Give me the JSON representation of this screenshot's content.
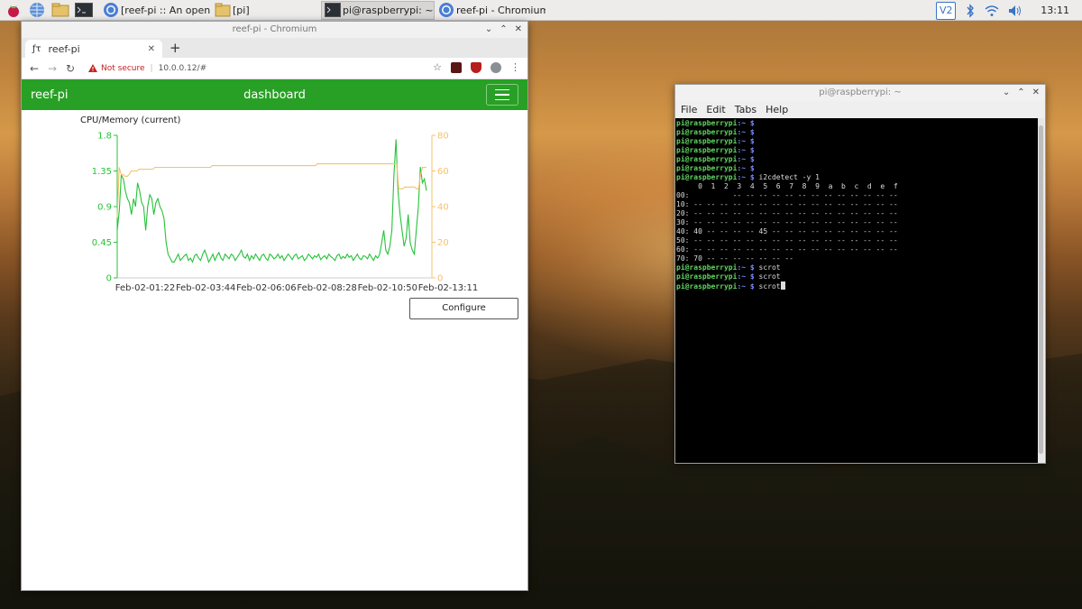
{
  "taskbar": {
    "launchers": [
      {
        "icon": "raspberry-menu-icon"
      },
      {
        "icon": "web-browser-icon"
      },
      {
        "icon": "file-manager-icon"
      },
      {
        "icon": "terminal-icon"
      }
    ],
    "tasks": [
      {
        "label": "[reef-pi :: An opensour...",
        "icon": "chromium-icon",
        "active": false
      },
      {
        "label": "[pi]",
        "icon": "folder-icon",
        "active": false
      },
      {
        "label": "pi@raspberrypi: ~",
        "icon": "terminal-icon",
        "active": true
      },
      {
        "label": "reef-pi - Chromium",
        "icon": "chromium-icon",
        "active": false
      }
    ],
    "tray": {
      "vnc": "V2",
      "clock": "13:11"
    }
  },
  "browser": {
    "window_title": "reef-pi - Chromium",
    "tab_title": "reef-pi",
    "url_warning": "Not secure",
    "url": "10.0.0.12/#",
    "app": {
      "brand": "reef-pi",
      "page_title": "dashboard",
      "configure_label": "Configure"
    }
  },
  "chart_data": {
    "type": "line",
    "title": "CPU/Memory (current)",
    "x_ticks": [
      "Feb-02-01:22",
      "Feb-02-03:44",
      "Feb-02-06:06",
      "Feb-02-08:28",
      "Feb-02-10:50",
      "Feb-02-13:11"
    ],
    "y_left": {
      "ticks": [
        "0",
        "0.45",
        "0.9",
        "1.35",
        "1.8"
      ],
      "lim": [
        0,
        1.8
      ],
      "color": "#26c23a"
    },
    "y_right": {
      "ticks": [
        "0",
        "20",
        "40",
        "60",
        "80"
      ],
      "lim": [
        0,
        80
      ],
      "color": "#f5c26b"
    },
    "series": [
      {
        "axis": "left",
        "color": "#26c23a",
        "values": [
          0.6,
          0.85,
          1.3,
          1.25,
          1.1,
          1.0,
          0.95,
          0.8,
          1.0,
          0.9,
          1.2,
          1.1,
          0.95,
          0.9,
          0.6,
          0.9,
          1.05,
          1.0,
          0.8,
          0.95,
          1.0,
          0.9,
          0.85,
          0.75,
          0.45,
          0.3,
          0.25,
          0.2,
          0.2,
          0.25,
          0.3,
          0.22,
          0.25,
          0.28,
          0.3,
          0.22,
          0.25,
          0.2,
          0.28,
          0.3,
          0.25,
          0.22,
          0.3,
          0.35,
          0.28,
          0.2,
          0.25,
          0.3,
          0.22,
          0.28,
          0.32,
          0.25,
          0.22,
          0.3,
          0.27,
          0.24,
          0.3,
          0.28,
          0.22,
          0.26,
          0.3,
          0.35,
          0.27,
          0.25,
          0.3,
          0.22,
          0.28,
          0.24,
          0.3,
          0.26,
          0.22,
          0.28,
          0.3,
          0.25,
          0.22,
          0.3,
          0.28,
          0.24,
          0.26,
          0.3,
          0.25,
          0.28,
          0.22,
          0.26,
          0.3,
          0.27,
          0.23,
          0.28,
          0.3,
          0.24,
          0.26,
          0.28,
          0.22,
          0.25,
          0.3,
          0.27,
          0.24,
          0.28,
          0.26,
          0.3,
          0.23,
          0.26,
          0.28,
          0.24,
          0.3,
          0.27,
          0.25,
          0.22,
          0.28,
          0.3,
          0.24,
          0.27,
          0.25,
          0.3,
          0.26,
          0.28,
          0.22,
          0.26,
          0.3,
          0.25,
          0.23,
          0.28,
          0.27,
          0.24,
          0.3,
          0.26,
          0.22,
          0.28,
          0.25,
          0.3,
          0.45,
          0.6,
          0.35,
          0.3,
          0.4,
          0.6,
          1.3,
          1.75,
          1.1,
          0.8,
          0.6,
          0.4,
          0.5,
          0.8,
          0.45,
          0.35,
          0.3,
          0.6,
          0.9,
          1.4,
          1.2,
          1.25,
          1.1
        ]
      },
      {
        "axis": "right",
        "color": "#f5c26b",
        "values": [
          34,
          62,
          58,
          58,
          57,
          57,
          58,
          60,
          60,
          60,
          60,
          61,
          61,
          61,
          61,
          61,
          61,
          61,
          61,
          62,
          62,
          62,
          62,
          62,
          62,
          62,
          62,
          62,
          62,
          62,
          62,
          62,
          62,
          62,
          62,
          62,
          62,
          62,
          62,
          62,
          62,
          62,
          62,
          62,
          62,
          62,
          62,
          62,
          63,
          63,
          63,
          63,
          63,
          63,
          63,
          63,
          63,
          63,
          63,
          63,
          63,
          63,
          63,
          63,
          63,
          63,
          63,
          63,
          63,
          63,
          63,
          63,
          63,
          63,
          63,
          63,
          63,
          63,
          63,
          63,
          63,
          63,
          63,
          63,
          63,
          63,
          63,
          63,
          63,
          63,
          63,
          63,
          63,
          63,
          63,
          63,
          63,
          63,
          63,
          63,
          63,
          64,
          64,
          64,
          64,
          64,
          64,
          64,
          64,
          64,
          64,
          64,
          64,
          64,
          64,
          64,
          64,
          64,
          64,
          64,
          64,
          64,
          64,
          64,
          64,
          64,
          64,
          64,
          64,
          64,
          64,
          64,
          64,
          64,
          64,
          64,
          64,
          64,
          64,
          64,
          64,
          64,
          50,
          50,
          50,
          51,
          51,
          51,
          51,
          51,
          51,
          50,
          50,
          58,
          62,
          62,
          62
        ]
      }
    ]
  },
  "terminal": {
    "window_title": "pi@raspberrypi: ~",
    "menu": [
      "File",
      "Edit",
      "Tabs",
      "Help"
    ],
    "prompt_user": "pi@raspberrypi",
    "prompt_path": ":~ $",
    "lines": [
      {
        "type": "prompt",
        "cmd": ""
      },
      {
        "type": "prompt",
        "cmd": ""
      },
      {
        "type": "prompt",
        "cmd": ""
      },
      {
        "type": "prompt",
        "cmd": ""
      },
      {
        "type": "prompt",
        "cmd": ""
      },
      {
        "type": "prompt",
        "cmd": ""
      },
      {
        "type": "prompt",
        "cmd": " i2cdetect -y 1"
      },
      {
        "type": "out",
        "text": "     0  1  2  3  4  5  6  7  8  9  a  b  c  d  e  f"
      },
      {
        "type": "out",
        "text": "00:          -- -- -- -- -- -- -- -- -- -- -- -- --"
      },
      {
        "type": "out",
        "text": "10: -- -- -- -- -- -- -- -- -- -- -- -- -- -- -- --"
      },
      {
        "type": "out",
        "text": "20: -- -- -- -- -- -- -- -- -- -- -- -- -- -- -- --"
      },
      {
        "type": "out",
        "text": "30: -- -- -- -- -- -- -- -- -- -- -- -- -- -- -- --"
      },
      {
        "type": "out",
        "text": "40: 40 -- -- -- -- 45 -- -- -- -- -- -- -- -- -- --"
      },
      {
        "type": "out",
        "text": "50: -- -- -- -- -- -- -- -- -- -- -- -- -- -- -- --"
      },
      {
        "type": "out",
        "text": "60: -- -- -- -- -- -- -- -- -- -- -- -- -- -- -- --"
      },
      {
        "type": "out",
        "text": "70: 70 -- -- -- -- -- -- --"
      },
      {
        "type": "prompt",
        "cmd": " scrot"
      },
      {
        "type": "prompt",
        "cmd": " scrot"
      },
      {
        "type": "prompt",
        "cmd": " scrot",
        "cursor": true
      }
    ]
  }
}
